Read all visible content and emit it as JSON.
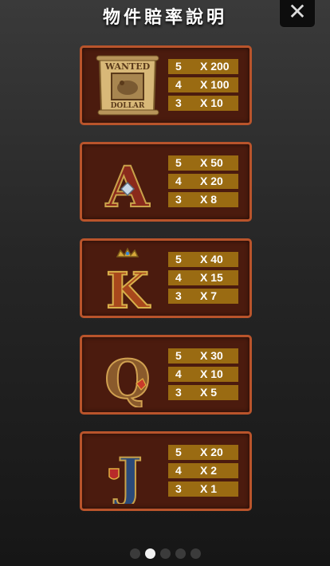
{
  "header": {
    "title": "物件賠率說明",
    "close_symbol": "✕"
  },
  "symbols": [
    {
      "name": "wanted-poster",
      "poster_top": "WANTED",
      "poster_bottom": "DOLLAR",
      "payouts": [
        {
          "count": "5",
          "mult": "X 200"
        },
        {
          "count": "4",
          "mult": "X 100"
        },
        {
          "count": "3",
          "mult": "X 10"
        }
      ]
    },
    {
      "name": "letter-A",
      "letter": "A",
      "payouts": [
        {
          "count": "5",
          "mult": "X 50"
        },
        {
          "count": "4",
          "mult": "X 20"
        },
        {
          "count": "3",
          "mult": "X 8"
        }
      ]
    },
    {
      "name": "letter-K",
      "letter": "K",
      "payouts": [
        {
          "count": "5",
          "mult": "X 40"
        },
        {
          "count": "4",
          "mult": "X 15"
        },
        {
          "count": "3",
          "mult": "X 7"
        }
      ]
    },
    {
      "name": "letter-Q",
      "letter": "Q",
      "payouts": [
        {
          "count": "5",
          "mult": "X 30"
        },
        {
          "count": "4",
          "mult": "X 10"
        },
        {
          "count": "3",
          "mult": "X 5"
        }
      ]
    },
    {
      "name": "letter-J",
      "letter": "J",
      "payouts": [
        {
          "count": "5",
          "mult": "X 20"
        },
        {
          "count": "4",
          "mult": "X 2"
        },
        {
          "count": "3",
          "mult": "X 1"
        }
      ]
    }
  ],
  "pagination": {
    "total_pages": 5,
    "current_page": 2
  },
  "colors": {
    "card_bg": "#4b1b0e",
    "card_border": "#b9542b",
    "payout_bg": "#9a6b12"
  }
}
